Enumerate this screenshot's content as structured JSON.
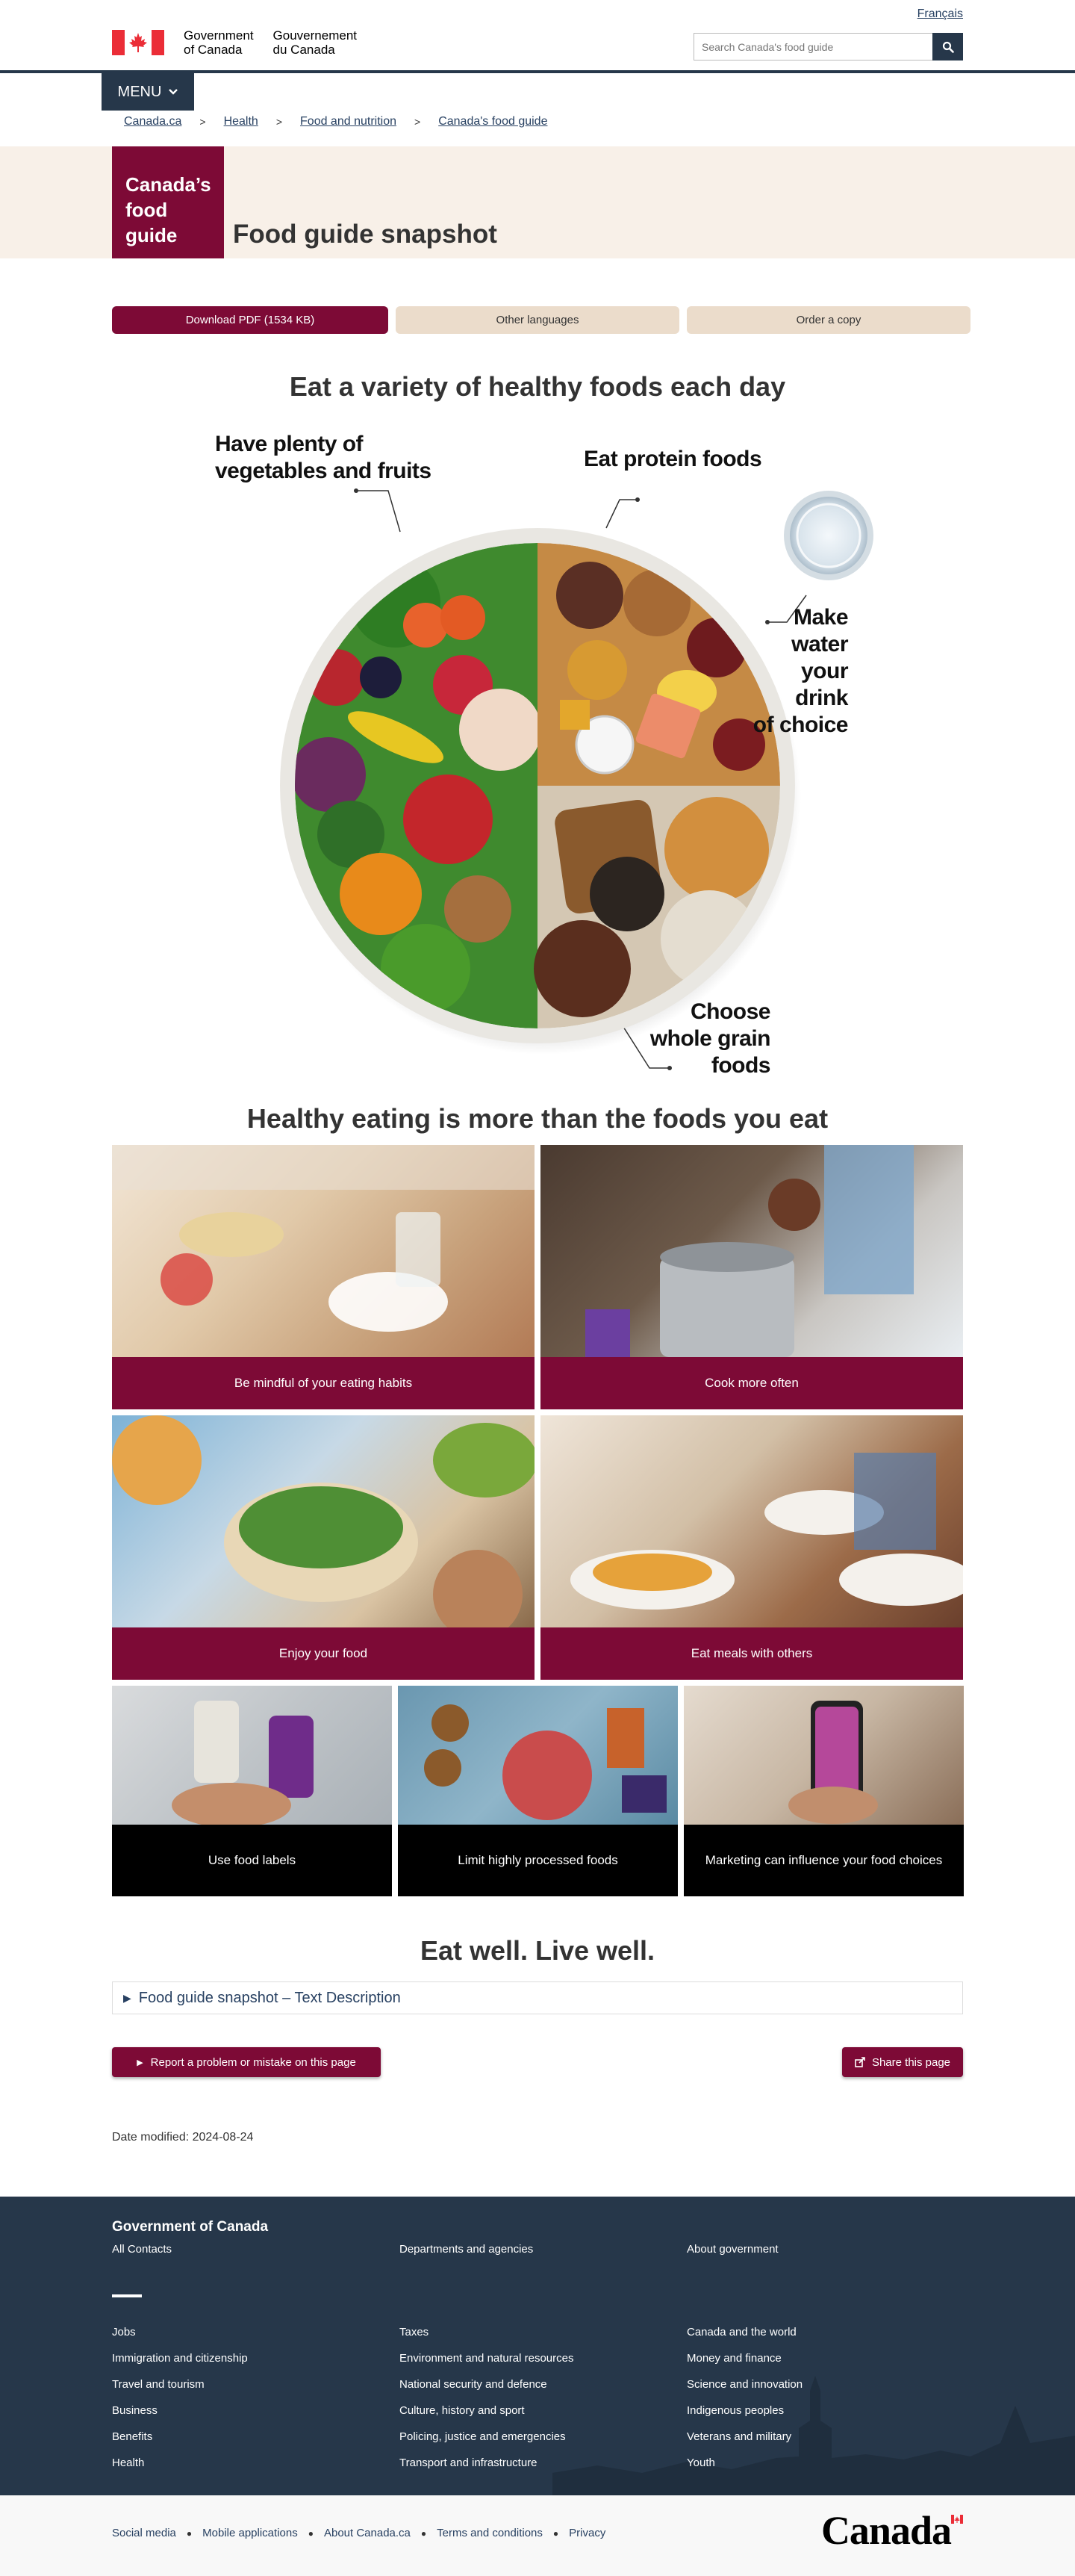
{
  "header": {
    "lang_link": "Français",
    "sig_en": "Government\nof Canada",
    "sig_fr": "Gouvernement\ndu Canada",
    "search_placeholder": "Search Canada's food guide"
  },
  "menu_label": "MENU",
  "breadcrumbs": [
    "Canada.ca",
    "Health",
    "Food and nutrition",
    "Canada's food guide"
  ],
  "hero": {
    "badge_line1": "Canada’s",
    "badge_line2": "food",
    "badge_line3": "guide",
    "title": "Food guide snapshot"
  },
  "actions": {
    "download": "Download PDF (1534 KB)",
    "languages": "Other languages",
    "order": "Order a copy"
  },
  "plate": {
    "heading": "Eat a variety of healthy foods each day",
    "veg_label_1": "Have plenty of",
    "veg_label_2": "vegetables and fruits",
    "protein_label": "Eat protein foods",
    "water_label_1": "Make water",
    "water_label_2": "your drink",
    "water_label_3": "of choice",
    "grain_label_1": "Choose",
    "grain_label_2": "whole grain",
    "grain_label_3": "foods"
  },
  "habits": {
    "heading": "Healthy eating is more than the foods you eat",
    "tile1": "Be mindful of your eating habits",
    "tile2": "Cook more often",
    "tile3": "Enjoy your food",
    "tile4": "Eat meals with others",
    "tile5": "Use food labels",
    "tile6": "Limit highly processed foods",
    "tile7": "Marketing can influence your food choices"
  },
  "closing_heading": "Eat well. Live well.",
  "details_summary": "Food guide snapshot – Text Description",
  "report_button": "Report a problem or mistake on this page",
  "share_button": "Share this page",
  "date_modified": "Date modified: 2024-08-24",
  "footer": {
    "heading": "Government of Canada",
    "top_links": [
      "All Contacts",
      "Departments and agencies",
      "About government"
    ],
    "col1": [
      "Jobs",
      "Immigration and citizenship",
      "Travel and tourism",
      "Business",
      "Benefits",
      "Health"
    ],
    "col2": [
      "Taxes",
      "Environment and natural resources",
      "National security and defence",
      "Culture, history and sport",
      "Policing, justice and emergencies",
      "Transport and infrastructure"
    ],
    "col3": [
      "Canada and the world",
      "Money and finance",
      "Science and innovation",
      "Indigenous peoples",
      "Veterans and military",
      "Youth"
    ],
    "sub_links": [
      "Social media",
      "Mobile applications",
      "About Canada.ca",
      "Terms and conditions",
      "Privacy"
    ],
    "wordmark": "Canada"
  },
  "colors": {
    "navy": "#26374a",
    "burgundy": "#7d0a36",
    "beige": "#f8f0e8",
    "tan": "#ebdccb",
    "link": "#284162"
  }
}
